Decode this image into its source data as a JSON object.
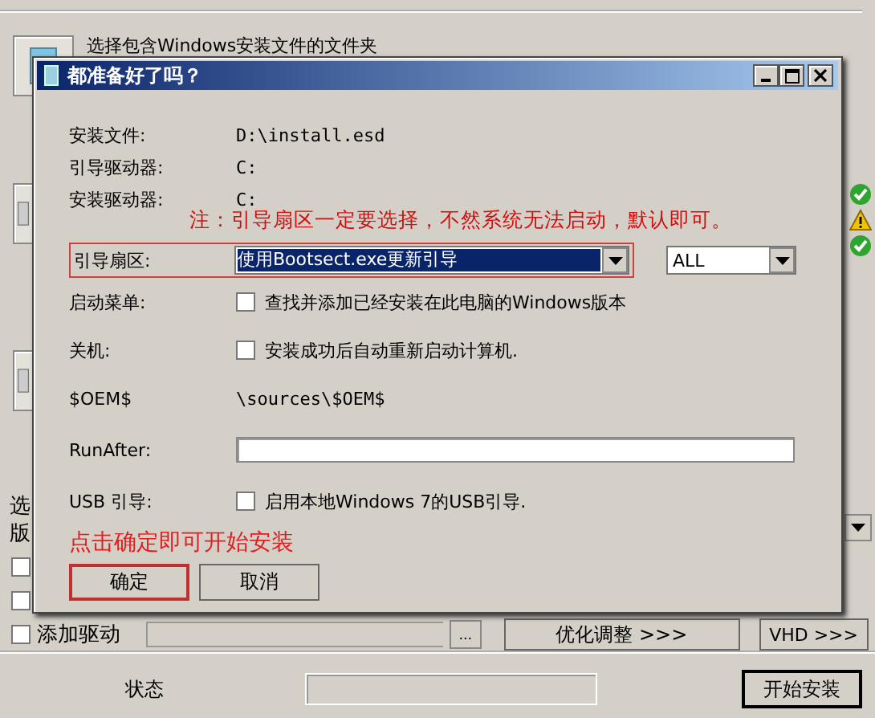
{
  "background": {
    "source_label": "选择包含Windows安装文件的文件夹",
    "status_icons": [
      {
        "kind": "ok"
      },
      {
        "kind": "warning"
      },
      {
        "kind": "ok"
      }
    ],
    "group_label": "选",
    "edition_label": "版",
    "options": [
      {
        "checked": false
      },
      {
        "checked": false
      },
      {
        "label": "添加驱动",
        "checked": false
      }
    ],
    "browse_button": "...",
    "tweak_button": "优化调整 >>>",
    "vhd_button": "VHD >>>",
    "status_label": "状态",
    "start_button": "开始安装"
  },
  "dialog": {
    "title": "都准备好了吗？",
    "info": [
      {
        "label": "安装文件:",
        "value": "D:\\install.esd"
      },
      {
        "label": "引导驱动器:",
        "value": "C:"
      },
      {
        "label": "安装驱动器:",
        "value": "C:"
      }
    ],
    "note": "注：引导扇区一定要选择，不然系统无法启动，默认即可。",
    "boot_sector": {
      "label": "引导扇区:",
      "value": "使用Bootsect.exe更新引导",
      "target": "ALL"
    },
    "checks": [
      {
        "label": "启动菜单:",
        "text": "查找并添加已经安装在此电脑的Windows版本",
        "checked": false
      },
      {
        "label": "关机:",
        "text": "安装成功后自动重新启动计算机.",
        "checked": false
      }
    ],
    "oem": {
      "label": "$OEM$",
      "value": "\\sources\\$OEM$"
    },
    "run_after": {
      "label": "RunAfter:"
    },
    "usb": {
      "label": "USB 引导:",
      "text": "启用本地Windows 7的USB引导.",
      "checked": false
    },
    "hint": "点击确定即可开始安装",
    "buttons": [
      {
        "label": "确定",
        "selected": true
      },
      {
        "label": "取消",
        "selected": false
      }
    ]
  }
}
